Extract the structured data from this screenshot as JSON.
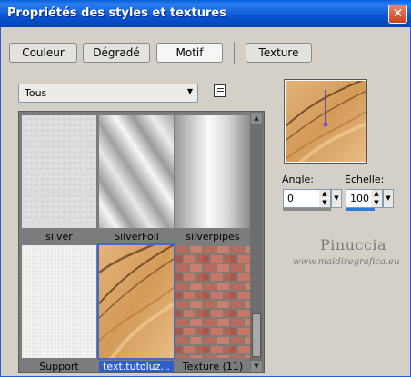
{
  "window": {
    "title": "Propriétés des styles et textures",
    "close_glyph": "✕"
  },
  "tabs": [
    {
      "label": "Couleur",
      "active": false
    },
    {
      "label": "Dégradé",
      "active": false
    },
    {
      "label": "Motif",
      "active": true
    },
    {
      "label": "Texture",
      "active": false
    }
  ],
  "category_select": {
    "value": "Tous",
    "arrow_icon": "dropdown-arrow-icon"
  },
  "gallery": {
    "items": [
      {
        "caption": "silver",
        "pattern": "silver-noise",
        "selected": false
      },
      {
        "caption": "SilverFoil",
        "pattern": "silver-foil-stripes",
        "selected": false
      },
      {
        "caption": "silverpipes",
        "pattern": "silver-pipe-gradient",
        "selected": false
      },
      {
        "caption": "Support",
        "pattern": "linen-white",
        "selected": false
      },
      {
        "caption": "text.tutoluz...",
        "pattern": "gold-brush-strokes",
        "selected": true
      },
      {
        "caption": "Texture (11)",
        "pattern": "brick-wall",
        "selected": false
      }
    ]
  },
  "preview": {
    "pattern": "gold-brush-strokes"
  },
  "angle": {
    "label": "Angle:",
    "value": "0"
  },
  "scale": {
    "label": "Échelle:",
    "value": "100"
  },
  "watermark": {
    "name": "Pinuccia",
    "url": "www.maidiregrafica.eu"
  },
  "colors": {
    "title_bar": "#0a55d0",
    "selection": "#2d5fc8",
    "gold": "#d9a463",
    "brick": "#b96a5e"
  }
}
